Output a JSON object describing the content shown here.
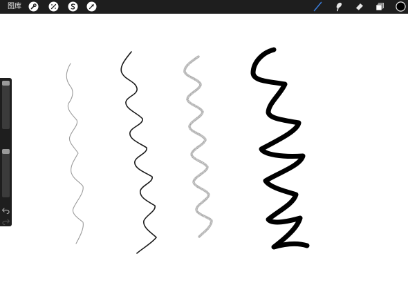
{
  "toolbar": {
    "gallery_label": "图库",
    "left_icons": [
      "wrench-icon",
      "adjustments-wand-icon",
      "selection-s-icon",
      "transform-arrow-icon"
    ],
    "right_icons": [
      "brush-icon",
      "smudge-icon",
      "eraser-icon",
      "layers-icon",
      "color-swatch-icon"
    ],
    "active_tool": "brush",
    "active_color": "#000000",
    "accent_color": "#3a7bd5"
  },
  "sidebar": {
    "brush_size_level": 0.02,
    "opacity_level": 0.02,
    "icons": [
      "undo-icon",
      "redo-icon"
    ]
  },
  "canvas": {
    "background": "#ffffff",
    "strokes": [
      {
        "name": "stroke-thin-pencil",
        "color": "#9a9a9a"
      },
      {
        "name": "stroke-fine-ink",
        "color": "#1a1a1a"
      },
      {
        "name": "stroke-soft-charcoal",
        "color": "#8a8a8a"
      },
      {
        "name": "stroke-bold-marker",
        "color": "#000000"
      }
    ]
  }
}
